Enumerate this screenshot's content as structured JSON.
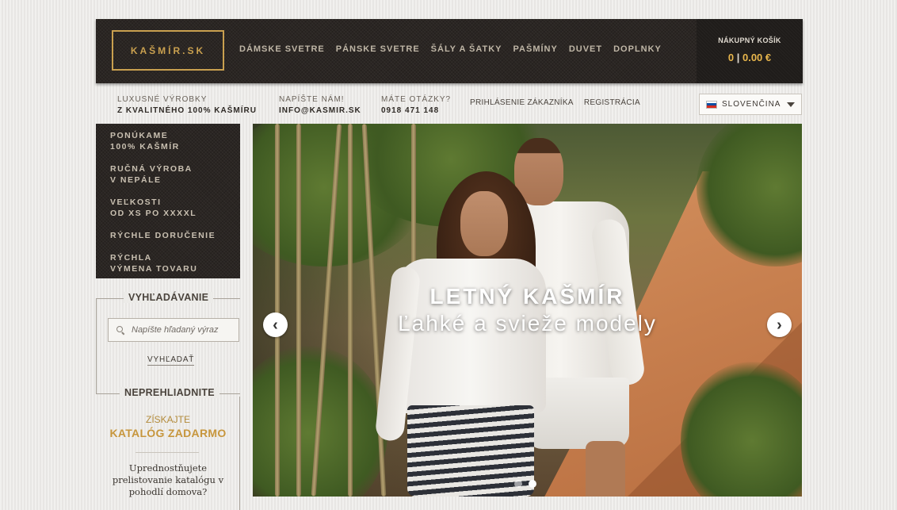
{
  "header": {
    "logo": "KAŠMÍR.SK",
    "nav": [
      "DÁMSKE SVETRE",
      "PÁNSKE SVETRE",
      "ŠÁLY A ŠATKY",
      "PAŠMÍNY",
      "DUVET",
      "DOPLNKY"
    ],
    "cart": {
      "title": "NÁKUPNÝ KOŠÍK",
      "count": "0",
      "separator": "|",
      "total": "0.00 €"
    }
  },
  "infobar": {
    "luxury": {
      "line1": "LUXUSNÉ VÝROBKY",
      "line2": "Z KVALITNÉHO 100% KAŠMÍRU"
    },
    "email": {
      "line1": "NAPÍŠTE NÁM!",
      "line2": "INFO@KASMIR.SK"
    },
    "phone": {
      "line1": "MÁTE OTÁZKY?",
      "line2": "0918 471 148"
    },
    "links": [
      "PRIHLÁSENIE ZÁKAZNÍKA",
      "REGISTRÁCIA"
    ],
    "language": "SLOVENČINA"
  },
  "features": [
    {
      "line1": "PONÚKAME",
      "line2": "100% KAŠMÍR"
    },
    {
      "line1": "RUČNÁ VÝROBA",
      "line2": "V NEPÁLE"
    },
    {
      "line1": "VEĽKOSTI",
      "line2": "OD XS PO XXXXL"
    },
    {
      "line1": "RÝCHLE DORUČENIE",
      "line2": ""
    },
    {
      "line1": "RÝCHLA",
      "line2": "VÝMENA TOVARU"
    }
  ],
  "search": {
    "title": "VYHĽADÁVANIE",
    "placeholder": "Napíšte hľadaný výraz",
    "button": "VYHĽADAŤ"
  },
  "catalog": {
    "title": "NEPREHLIADNITE",
    "lead": "ZÍSKAJTE",
    "highlight": "KATALÓG ZADARMO",
    "desc": "Uprednostňujete prelistovanie katalógu v pohodlí domova?"
  },
  "slider": {
    "title": "LETNÝ KAŠMÍR",
    "subtitle": "Ľahké a svieže modely",
    "prev_icon": "chevron-left-icon",
    "next_icon": "chevron-right-icon",
    "slides_total": 2,
    "active_slide": 2
  },
  "colors": {
    "accent": "#c7963d",
    "header_bg": "#2b2623",
    "nav_text": "#bfb6a6"
  }
}
